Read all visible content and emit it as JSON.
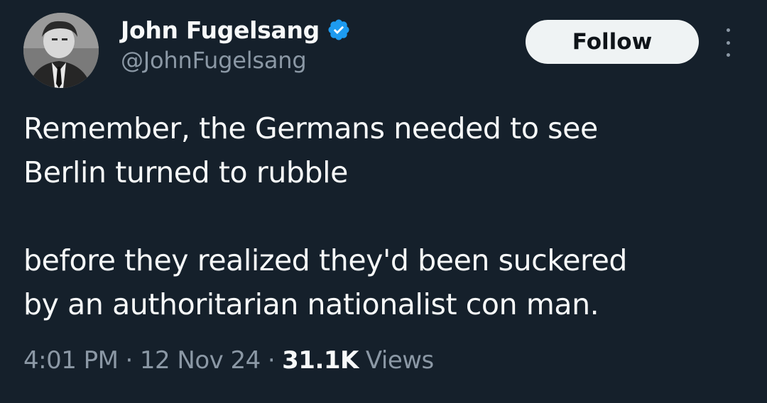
{
  "author": {
    "display_name": "John Fugelsang",
    "handle": "@JohnFugelsang",
    "verified": true,
    "avatar_icon": "profile-photo"
  },
  "actions": {
    "follow_label": "Follow",
    "more_icon": "more-vertical-icon"
  },
  "tweet": {
    "paragraphs": [
      {
        "lines": [
          "Remember, the Germans needed to see",
          "Berlin turned to rubble"
        ]
      },
      {
        "lines": [
          "before they realized they'd been suckered",
          "by an authoritarian nationalist con man."
        ]
      }
    ]
  },
  "meta": {
    "time": "4:01 PM",
    "separator": "·",
    "date": "12 Nov 24",
    "views_count": "31.1K",
    "views_label": "Views"
  },
  "colors": {
    "background": "#15202b",
    "text_primary": "#f7f9f9",
    "text_secondary": "#8b98a5",
    "verified_badge": "#1d9bf0",
    "follow_button_bg": "#eff3f4",
    "follow_button_text": "#0f1419"
  }
}
